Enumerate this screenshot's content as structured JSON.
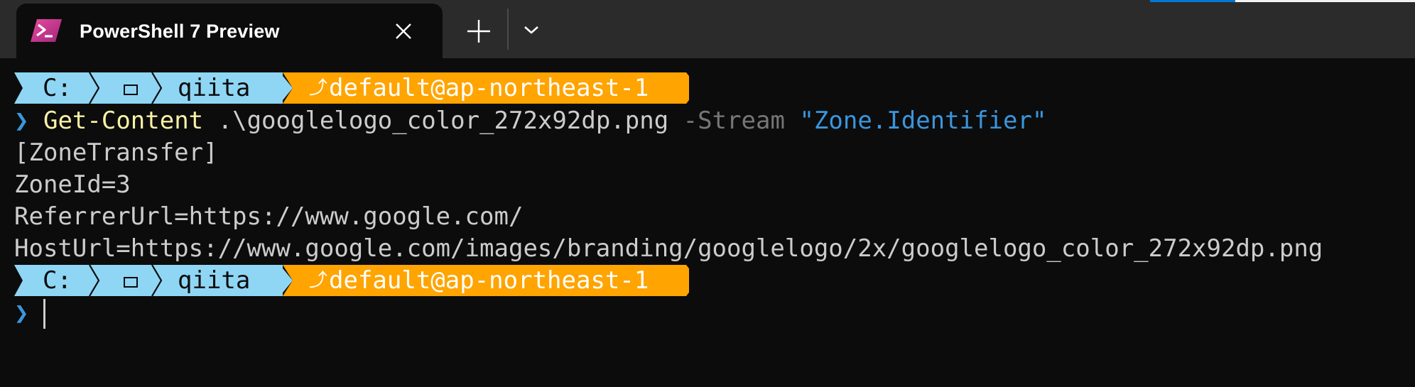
{
  "window": {
    "tab_title": "PowerShell 7 Preview",
    "tab_icon": "powershell-icon",
    "close_icon": "close-icon",
    "new_tab_icon": "plus-icon",
    "dropdown_icon": "chevron-down-icon"
  },
  "colors": {
    "prompt_path_bg": "#8fd6f5",
    "prompt_aws_bg": "#ffa400",
    "caret": "#3a96dd",
    "command": "#f9f1a5",
    "parameter": "#767676",
    "string": "#3a96dd"
  },
  "prompt": {
    "drive": "C:",
    "folder_icon": "folder-icon",
    "folder": "qiita",
    "aws_icon": "aws-icon",
    "aws_profile": "default@ap-northeast-1"
  },
  "terminal": {
    "caret": "❯",
    "command": {
      "name": "Get-Content",
      "arg": ".\\googlelogo_color_272x92dp.png",
      "param": "-Stream",
      "value": "\"Zone.Identifier\""
    },
    "output": [
      "[ZoneTransfer]",
      "ZoneId=3",
      "ReferrerUrl=https://www.google.com/",
      "HostUrl=https://www.google.com/images/branding/googlelogo/2x/googlelogo_color_272x92dp.png"
    ]
  }
}
